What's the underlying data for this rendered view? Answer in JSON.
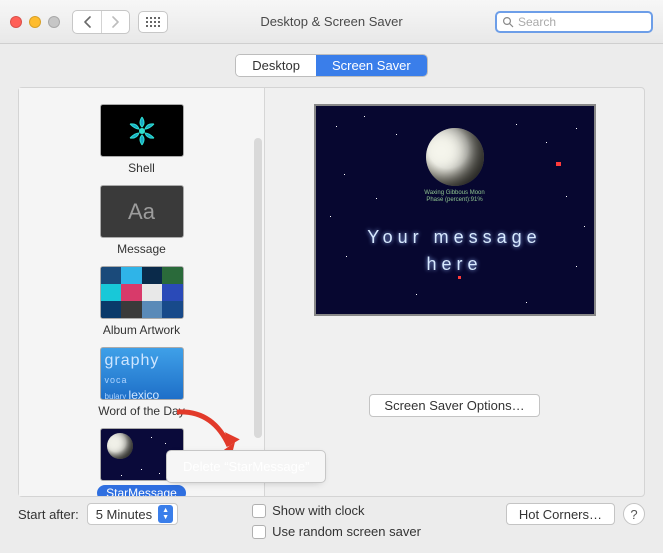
{
  "window": {
    "title": "Desktop & Screen Saver"
  },
  "search": {
    "placeholder": "Search"
  },
  "tabs": {
    "desktop": "Desktop",
    "screensaver": "Screen Saver"
  },
  "sidebar": {
    "items": [
      {
        "label": "Shell"
      },
      {
        "label": "Message",
        "glyph": "Aa"
      },
      {
        "label": "Album Artwork"
      },
      {
        "label": "Word of the Day",
        "line1": "graphy",
        "line2": "voca",
        "line3": "bulary",
        "line4": "lexico"
      },
      {
        "label": "StarMessage",
        "selected": true
      }
    ]
  },
  "preview": {
    "moon_line1": "Waxing Gibbous Moon",
    "moon_line2": "Phase (percent):91%",
    "message_line1": "Your message",
    "message_line2": "here",
    "options_button": "Screen Saver Options…"
  },
  "context_menu": {
    "delete_label": "Delete “StarMessage”"
  },
  "footer": {
    "start_label": "Start after:",
    "start_value": "5 Minutes",
    "show_clock": "Show with clock",
    "random": "Use random screen saver",
    "hot_corners": "Hot Corners…",
    "help": "?"
  }
}
